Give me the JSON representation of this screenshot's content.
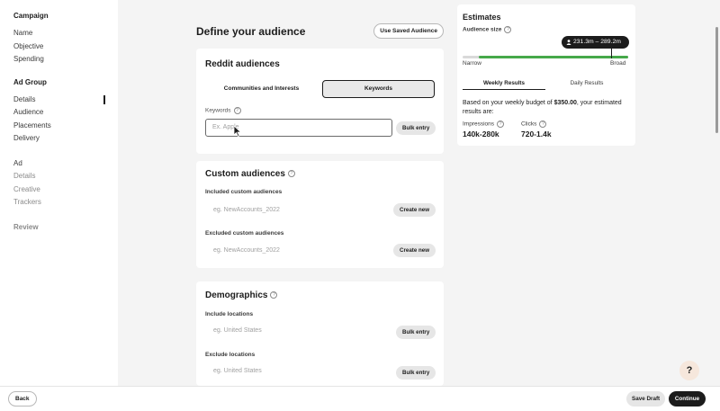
{
  "sidebar": {
    "campaign_heading": "Campaign",
    "campaign_items": [
      "Name",
      "Objective",
      "Spending"
    ],
    "adgroup_heading": "Ad Group",
    "adgroup_items": [
      "Details",
      "Audience",
      "Placements",
      "Delivery"
    ],
    "ad_heading": "Ad",
    "ad_items": [
      "Details",
      "Creative",
      "Trackers"
    ],
    "review": "Review"
  },
  "main": {
    "title": "Define your audience",
    "use_saved_audience": "Use Saved Audience",
    "reddit_audiences": {
      "title": "Reddit audiences",
      "toggle_left": "Communities and Interests",
      "toggle_right": "Keywords",
      "keywords_label": "Keywords",
      "keywords_placeholder": "Ex. Apple",
      "bulk_entry": "Bulk entry"
    },
    "custom_audiences": {
      "title": "Custom audiences",
      "included_label": "Included custom audiences",
      "included_placeholder": "eg. NewAccounts_2022",
      "excluded_label": "Excluded custom audiences",
      "excluded_placeholder": "eg. NewAccounts_2022",
      "create_new": "Create new"
    },
    "demographics": {
      "title": "Demographics",
      "include_label": "Include locations",
      "include_placeholder": "eg. United States",
      "exclude_label": "Exclude locations",
      "exclude_placeholder": "eg. United States",
      "bulk_entry": "Bulk entry"
    }
  },
  "estimates": {
    "title": "Estimates",
    "audience_size_label": "Audience size",
    "audience_size_value": "231.3m – 289.2m",
    "narrow": "Narrow",
    "broad": "Broad",
    "tab_weekly": "Weekly Results",
    "tab_daily": "Daily Results",
    "desc_prefix": "Based on your weekly budget of ",
    "budget": "$350.00",
    "desc_suffix": ", your estimated results are:",
    "impressions_label": "Impressions",
    "impressions_value": "140k-280k",
    "clicks_label": "Clicks",
    "clicks_value": "720-1.4k"
  },
  "footer": {
    "back": "Back",
    "save_draft": "Save Draft",
    "continue": "Continue"
  },
  "help": "?",
  "colors": {
    "accent_green": "#46a94a",
    "dark": "#1c1c1c",
    "help_bg": "#f6e7dc"
  }
}
